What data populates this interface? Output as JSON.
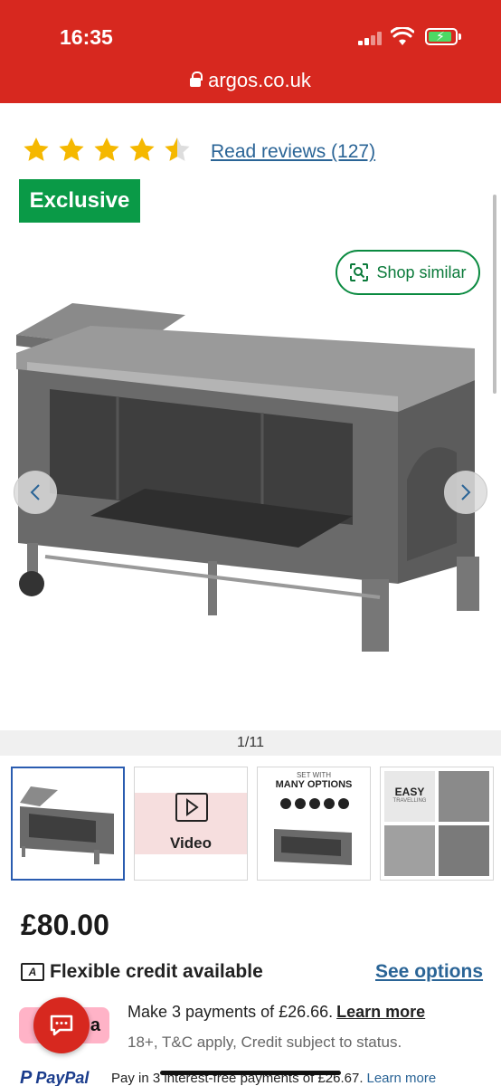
{
  "status_bar": {
    "time": "16:35"
  },
  "browser": {
    "url": "argos.co.uk"
  },
  "rating": {
    "stars": 4.5,
    "reviews_label": "Read reviews (127)"
  },
  "badge": {
    "label": "Exclusive"
  },
  "shop_similar": {
    "label": "Shop similar"
  },
  "gallery": {
    "counter": "1/11",
    "thumbs": [
      {
        "type": "image"
      },
      {
        "type": "video",
        "label": "Video"
      },
      {
        "type": "image",
        "caption_small": "SET WITH",
        "caption_large": "MANY OPTIONS"
      },
      {
        "type": "image",
        "caption_large": "EASY",
        "caption_small": "TRAVELLING"
      }
    ]
  },
  "price": "£80.00",
  "credit": {
    "icon_letter": "A",
    "label": "Flexible credit available",
    "link": "See options"
  },
  "klarna": {
    "logo_text": "a",
    "text": "Make 3 payments of £26.66.",
    "link": "Learn more",
    "sub": "18+, T&C apply, Credit subject to status."
  },
  "paypal": {
    "logo": "PayPal",
    "text": "Pay in 3 interest-free payments of £26.67.",
    "link": "Learn more"
  },
  "colors": {
    "brand_red": "#d7281f",
    "exclusive_green": "#0a9a47",
    "link_blue": "#2a6496"
  }
}
